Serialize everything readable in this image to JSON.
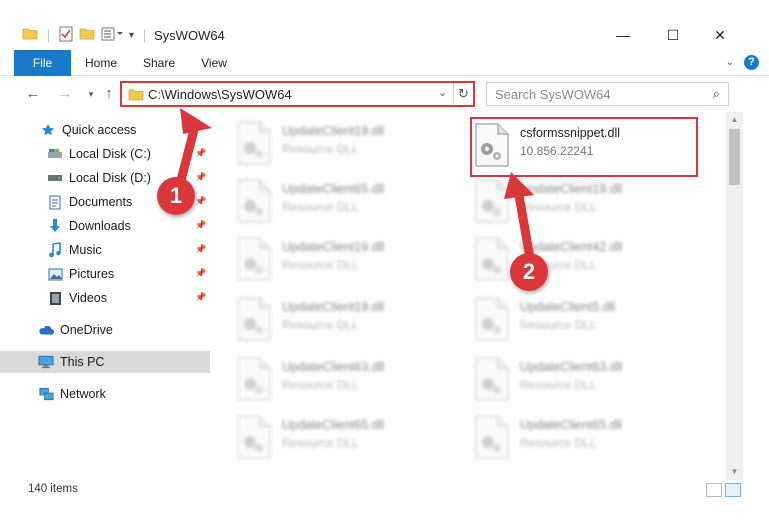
{
  "window": {
    "title": "SysWOW64",
    "min_symbol": "—",
    "max_symbol": "☐",
    "close_symbol": "✕"
  },
  "ribbon": {
    "tabs": [
      {
        "label": "File"
      },
      {
        "label": "Home"
      },
      {
        "label": "Share"
      },
      {
        "label": "View"
      }
    ],
    "help": "?"
  },
  "nav": {
    "address_path": "C:\\Windows\\SysWOW64",
    "search_placeholder": "Search SysWOW64"
  },
  "sidebar": {
    "items": [
      {
        "label": "Quick access",
        "icon": "star-icon"
      },
      {
        "label": "Local Disk (C:)",
        "icon": "drive-icon",
        "pinned": true
      },
      {
        "label": "Local Disk (D:)",
        "icon": "drive-icon",
        "pinned": true
      },
      {
        "label": "Documents",
        "icon": "documents-icon",
        "pinned": true
      },
      {
        "label": "Downloads",
        "icon": "downloads-icon",
        "pinned": true
      },
      {
        "label": "Music",
        "icon": "music-icon",
        "pinned": true
      },
      {
        "label": "Pictures",
        "icon": "pictures-icon",
        "pinned": true
      },
      {
        "label": "Videos",
        "icon": "videos-icon",
        "pinned": true
      },
      {
        "label": "OneDrive",
        "icon": "cloud-icon"
      },
      {
        "label": "This PC",
        "icon": "computer-icon",
        "selected": true
      },
      {
        "label": "Network",
        "icon": "network-icon"
      }
    ]
  },
  "files": {
    "left_column": [
      {
        "name": "UpdateClient19.dll",
        "desc": "Resource DLL"
      },
      {
        "name": "UpdateClient65.dll",
        "desc": "Resource DLL"
      },
      {
        "name": "UpdateClient19.dll",
        "desc": "Resource DLL"
      },
      {
        "name": "UpdateClient19.dll",
        "desc": "Resource DLL"
      },
      {
        "name": "UpdateClient63.dll",
        "desc": "Resource DLL"
      },
      {
        "name": "UpdateClient65.dll",
        "desc": "Resource DLL"
      }
    ],
    "highlighted": {
      "name": "csformssnippet.dll",
      "desc": "10.856.22241"
    },
    "right_column": [
      {
        "name": "UpdateClient19.dll",
        "desc": "Resource DLL"
      },
      {
        "name": "UpdateClient42.dll",
        "desc": "Resource DLL"
      },
      {
        "name": "UpdateClient5.dll",
        "desc": "Resource DLL"
      },
      {
        "name": "UpdateClient63.dll",
        "desc": "Resource DLL"
      },
      {
        "name": "UpdateClient65.dll",
        "desc": "Resource DLL"
      }
    ]
  },
  "status": {
    "item_count": "140 items"
  },
  "callouts": {
    "one": "1",
    "two": "2"
  },
  "colors": {
    "accent": "#1979ca",
    "annotation_red": "#d9373a",
    "selected_bg": "#d9d9d9"
  }
}
